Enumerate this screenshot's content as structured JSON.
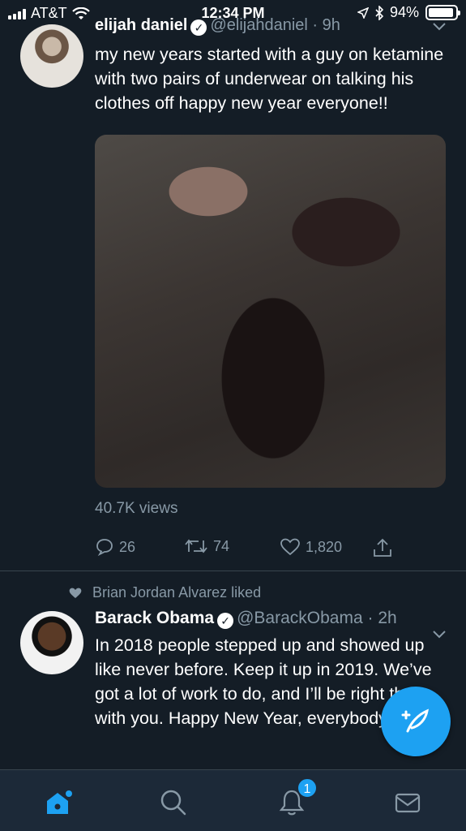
{
  "status_bar": {
    "carrier": "AT&T",
    "time": "12:34 PM",
    "battery": "94%",
    "battery_level": 0.94
  },
  "tweet1": {
    "name": "elijah daniel",
    "handle": "@elijahdaniel",
    "time": "9h",
    "text": "my new years started with a guy on ketamine with two pairs of underwear on talking his clothes off happy new year everyone!!",
    "views": "40.7K views",
    "replies": "26",
    "retweets": "74",
    "likes": "1,820"
  },
  "tweet2": {
    "liked_by": "Brian Jordan Alvarez liked",
    "name": "Barack Obama",
    "handle": "@BarackObama",
    "time": "2h",
    "text": "In 2018 people stepped up and showed up like never before. Keep it up in 2019. We’ve got a lot of work to do, and I’ll be right there with you. Happy New Year, everybody!"
  },
  "tab_bar": {
    "notifications_badge": "1"
  },
  "colors": {
    "background": "#141d26",
    "accent": "#1da1f2",
    "secondary_text": "#8899a6"
  }
}
